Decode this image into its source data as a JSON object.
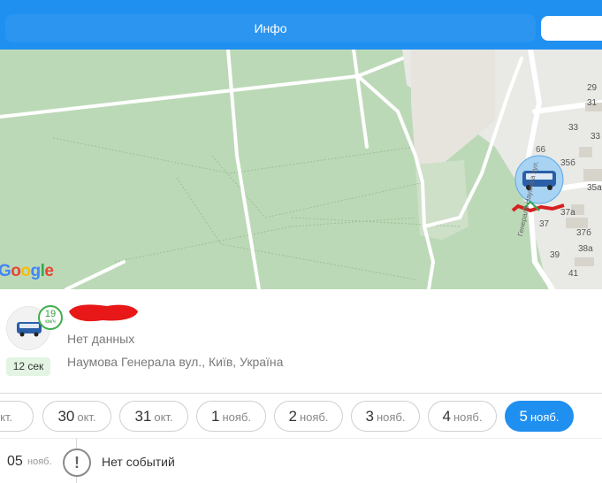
{
  "header": {
    "tab_label": "Инфо"
  },
  "map": {
    "logo": [
      "G",
      "o",
      "o",
      "g",
      "l",
      "e"
    ],
    "house_numbers": [
      "29",
      "31",
      "33",
      "33",
      "66",
      "35б",
      "35а",
      "37а",
      "37",
      "37б",
      "38а",
      "39",
      "41"
    ],
    "street_label": "Генерала Наумова вул.",
    "colors": {
      "park": "#bcd9b7",
      "urban": "#e8e8e6",
      "road": "#ffffff"
    }
  },
  "vehicle": {
    "speed": "19",
    "speed_unit": "км/ч",
    "age": "12 сек",
    "status": "Нет данных",
    "address": "Наумова Генерала вул., Київ, Україна"
  },
  "dates": [
    {
      "num": "",
      "mon": "окт.",
      "active": false
    },
    {
      "num": "30",
      "mon": "окт.",
      "active": false
    },
    {
      "num": "31",
      "mon": "окт.",
      "active": false
    },
    {
      "num": "1",
      "mon": "нояб.",
      "active": false
    },
    {
      "num": "2",
      "mon": "нояб.",
      "active": false
    },
    {
      "num": "3",
      "mon": "нояб.",
      "active": false
    },
    {
      "num": "4",
      "mon": "нояб.",
      "active": false
    },
    {
      "num": "5",
      "mon": "нояб.",
      "active": true
    }
  ],
  "timeline": {
    "day": "05",
    "month": "нояб.",
    "icon": "!",
    "text": "Нет событий"
  },
  "accent_color": "#1f8ff0"
}
